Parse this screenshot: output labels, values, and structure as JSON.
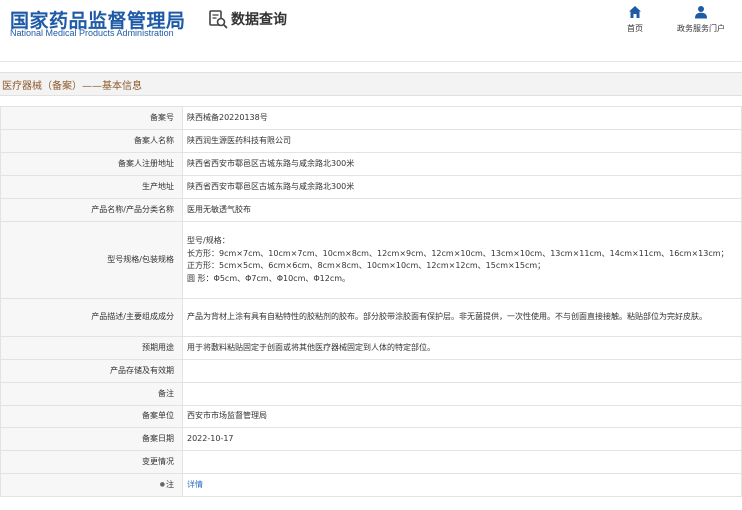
{
  "header": {
    "logo_cn": "国家药品监督管理局",
    "logo_en": "National Medical Products Administration",
    "query_label": "数据查询",
    "nav": [
      {
        "label": "首页",
        "icon": "home-icon"
      },
      {
        "label": "政务服务门户",
        "icon": "user-icon"
      }
    ]
  },
  "section": {
    "title": "医疗器械（备案）——基本信息"
  },
  "rows": {
    "record_no": {
      "label": "备案号",
      "value": "陕西械备20220138号"
    },
    "filer_name": {
      "label": "备案人名称",
      "value": "陕西润生源医药科技有限公司"
    },
    "filer_address": {
      "label": "备案人注册地址",
      "value": "陕西省西安市鄠邑区古城东路与咸余路北300米"
    },
    "production_address": {
      "label": "生产地址",
      "value": "陕西省西安市鄠邑区古城东路与咸余路北300米"
    },
    "product_name": {
      "label": "产品名称/产品分类名称",
      "value": "医用无敏透气胶布"
    },
    "model_spec": {
      "label": "型号规格/包装规格",
      "lines": [
        "型号/规格：",
        "长方形：9cm×7cm、10cm×7cm、10cm×8cm、12cm×9cm、12cm×10cm、13cm×10cm、13cm×11cm、14cm×11cm、16cm×13cm；",
        "正方形：5cm×5cm、6cm×6cm、8cm×8cm、10cm×10cm、12cm×12cm、15cm×15cm；",
        "圆 形：Φ5cm、Φ7cm、Φ10cm、Φ12cm。"
      ]
    },
    "description": {
      "label": "产品描述/主要组成成分",
      "value": "产品为背材上涂有具有自粘特性的胶粘剂的胶布。部分胶带涂胶面有保护层。非无菌提供，一次性使用。不与创面直接接触。粘贴部位为完好皮肤。"
    },
    "intended_use": {
      "label": "预期用途",
      "value": "用于将敷料粘贴固定于创面或将其他医疗器械固定到人体的特定部位。"
    },
    "storage": {
      "label": "产品存储及有效期",
      "value": ""
    },
    "remarks": {
      "label": "备注",
      "value": ""
    },
    "record_unit": {
      "label": "备案单位",
      "value": "西安市市场监督管理局"
    },
    "record_date": {
      "label": "备案日期",
      "value": "2022-10-17"
    },
    "change_info": {
      "label": "变更情况",
      "value": ""
    },
    "note": {
      "label": "注",
      "marker": "●",
      "link": "详情"
    }
  },
  "colors": {
    "brand_blue": "#1f5aa6",
    "section_brown": "#8c5a2b",
    "link_blue": "#2b6cc4"
  }
}
